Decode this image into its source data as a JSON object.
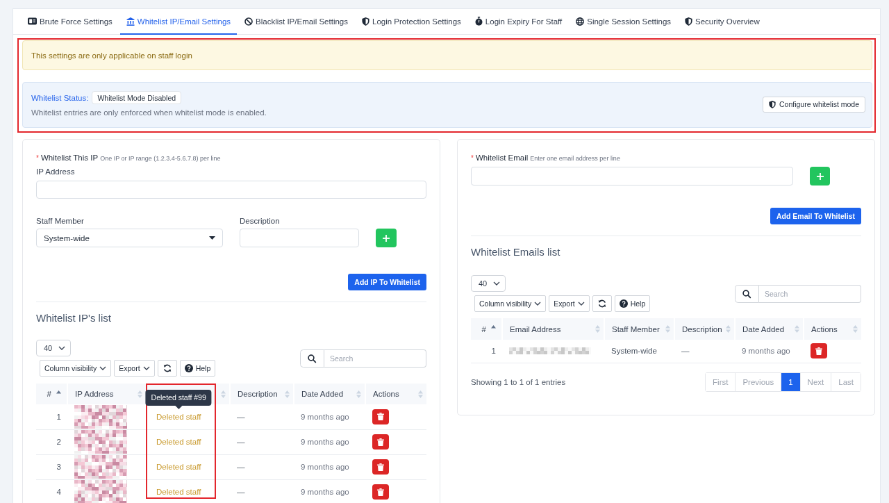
{
  "tabs": [
    {
      "label": "Brute Force Settings",
      "selected": false
    },
    {
      "label": "Whitelist IP/Email Settings",
      "selected": true
    },
    {
      "label": "Blacklist IP/Email Settings",
      "selected": false
    },
    {
      "label": "Login Protection Settings",
      "selected": false
    },
    {
      "label": "Login Expiry For Staff",
      "selected": false
    },
    {
      "label": "Single Session Settings",
      "selected": false
    },
    {
      "label": "Security Overview",
      "selected": false
    }
  ],
  "alerts": {
    "highlighted": true,
    "notice": "This settings are only applicable on staff login",
    "status": {
      "label": "Whitelist Status:",
      "badge": "Whitelist Mode Disabled",
      "note": "Whitelist entries are only enforced when whitelist mode is enabled.",
      "button": "Configure whitelist mode"
    }
  },
  "ip_form": {
    "required_mark": "*",
    "title": "Whitelist This IP",
    "hint": "One IP or IP range (1.2.3.4-5.6.7.8) per line",
    "ip_label": "IP Address",
    "staff_label": "Staff Member",
    "staff_value": "System-wide",
    "description_label": "Description",
    "submit": "Add IP To Whitelist"
  },
  "ip_list": {
    "title": "Whitelist IP's list",
    "page_size": "40",
    "buttons": [
      {
        "kind": "dropdown",
        "label": "Column visibility"
      },
      {
        "kind": "dropdown",
        "label": "Export"
      },
      {
        "kind": "refresh"
      },
      {
        "kind": "help",
        "label": "Help"
      }
    ],
    "search": {
      "placeholder": "Search"
    },
    "columns": [
      {
        "label": "#",
        "sorted": true,
        "highlighted": false
      },
      {
        "label": "IP Address",
        "sorted": false,
        "highlighted": false
      },
      {
        "sorted": false,
        "highlighted": true
      },
      {
        "label": "Description",
        "sorted": false,
        "highlighted": false
      },
      {
        "label": "Date Added",
        "sorted": false,
        "highlighted": false
      },
      {
        "label": "Actions",
        "sorted": false,
        "highlighted": false
      }
    ],
    "rows": [
      {
        "number": "1",
        "staff": "Deleted staff",
        "staff_deleted": true,
        "tooltip": "Deleted staff #99",
        "description": "—",
        "date": "9 months ago"
      },
      {
        "number": "2",
        "staff": "Deleted staff",
        "staff_deleted": true,
        "description": "—",
        "date": "9 months ago"
      },
      {
        "number": "3",
        "staff": "Deleted staff",
        "staff_deleted": true,
        "description": "—",
        "date": "9 months ago"
      },
      {
        "number": "4",
        "staff": "Deleted staff",
        "staff_deleted": true,
        "description": "—",
        "date": "9 months ago"
      }
    ]
  },
  "email_form": {
    "required_mark": "*",
    "title": "Whitelist Email",
    "hint": "Enter one email address per line",
    "submit": "Add Email To Whitelist"
  },
  "email_list": {
    "title": "Whitelist Emails list",
    "page_size": "40",
    "buttons": [
      {
        "kind": "dropdown",
        "label": "Column visibility"
      },
      {
        "kind": "dropdown",
        "label": "Export"
      },
      {
        "kind": "refresh"
      },
      {
        "kind": "help",
        "label": "Help"
      }
    ],
    "search": {
      "placeholder": "Search"
    },
    "columns": [
      {
        "label": "#",
        "sorted": true,
        "highlighted": false
      },
      {
        "label": "Email Address",
        "sorted": false,
        "highlighted": false
      },
      {
        "label": "Staff Member",
        "sorted": false,
        "highlighted": false
      },
      {
        "label": "Description",
        "sorted": false,
        "highlighted": false
      },
      {
        "label": "Date Added",
        "sorted": false,
        "highlighted": false
      },
      {
        "label": "Actions",
        "sorted": false,
        "highlighted": false
      }
    ],
    "rows": [
      {
        "number": "1",
        "staff": "System-wide",
        "staff_deleted": false,
        "description": "—",
        "date": "9 months ago"
      }
    ],
    "info": "Showing 1 to 1 of 1 entries",
    "pagination": [
      {
        "label": "First",
        "selected": false,
        "disabled": true
      },
      {
        "label": "Previous",
        "selected": false,
        "disabled": true
      },
      {
        "label": "1",
        "selected": true,
        "disabled": false
      },
      {
        "label": "Next",
        "selected": false,
        "disabled": true
      },
      {
        "label": "Last",
        "selected": false,
        "disabled": true
      }
    ]
  }
}
